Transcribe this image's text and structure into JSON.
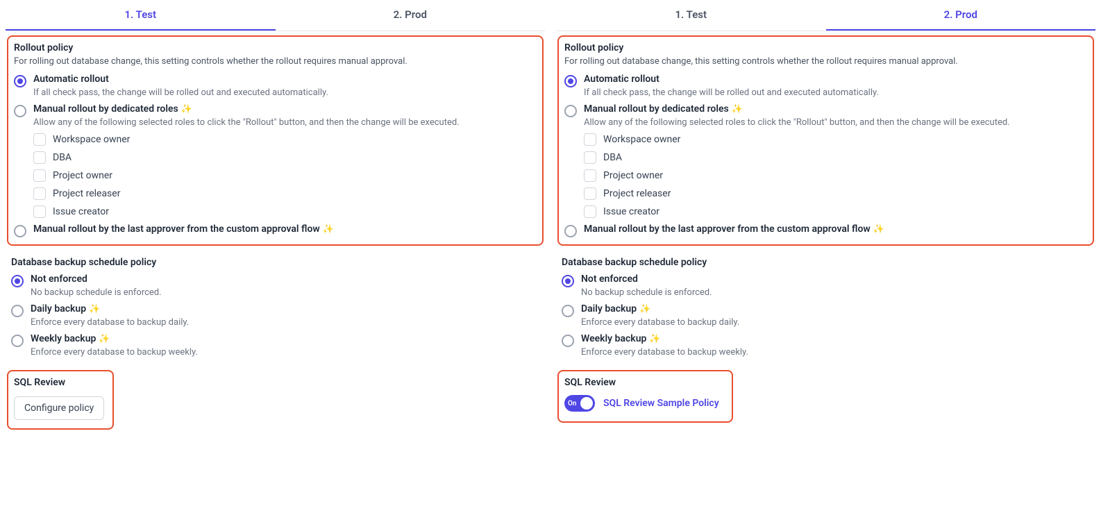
{
  "left": {
    "tabs": {
      "test": "1. Test",
      "prod": "2. Prod"
    },
    "rollout": {
      "title": "Rollout policy",
      "desc": "For rolling out database change, this setting controls whether the rollout requires manual approval.",
      "auto": {
        "label": "Automatic rollout",
        "desc": "If all check pass, the change will be rolled out and executed automatically."
      },
      "manual_roles": {
        "label": "Manual rollout by dedicated roles",
        "desc": "Allow any of the following selected roles to click the \"Rollout\" button, and then the change will be executed.",
        "roles": [
          "Workspace owner",
          "DBA",
          "Project owner",
          "Project releaser",
          "Issue creator"
        ]
      },
      "manual_last": {
        "label": "Manual rollout by the last approver from the custom approval flow"
      }
    },
    "backup": {
      "title": "Database backup schedule policy",
      "not_enforced": {
        "label": "Not enforced",
        "desc": "No backup schedule is enforced."
      },
      "daily": {
        "label": "Daily backup",
        "desc": "Enforce every database to backup daily."
      },
      "weekly": {
        "label": "Weekly backup",
        "desc": "Enforce every database to backup weekly."
      }
    },
    "sql_review": {
      "title": "SQL Review",
      "button": "Configure policy"
    }
  },
  "right": {
    "tabs": {
      "test": "1. Test",
      "prod": "2. Prod"
    },
    "rollout": {
      "title": "Rollout policy",
      "desc": "For rolling out database change, this setting controls whether the rollout requires manual approval.",
      "auto": {
        "label": "Automatic rollout",
        "desc": "If all check pass, the change will be rolled out and executed automatically."
      },
      "manual_roles": {
        "label": "Manual rollout by dedicated roles",
        "desc": "Allow any of the following selected roles to click the \"Rollout\" button, and then the change will be executed.",
        "roles": [
          "Workspace owner",
          "DBA",
          "Project owner",
          "Project releaser",
          "Issue creator"
        ]
      },
      "manual_last": {
        "label": "Manual rollout by the last approver from the custom approval flow"
      }
    },
    "backup": {
      "title": "Database backup schedule policy",
      "not_enforced": {
        "label": "Not enforced",
        "desc": "No backup schedule is enforced."
      },
      "daily": {
        "label": "Daily backup",
        "desc": "Enforce every database to backup daily."
      },
      "weekly": {
        "label": "Weekly backup",
        "desc": "Enforce every database to backup weekly."
      }
    },
    "sql_review": {
      "title": "SQL Review",
      "toggle_text": "On",
      "link": "SQL Review Sample Policy"
    }
  }
}
